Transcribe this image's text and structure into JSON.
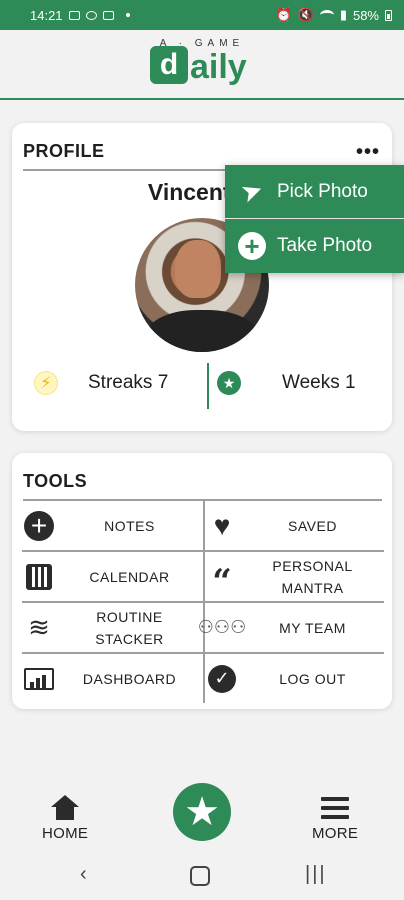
{
  "status_bar": {
    "time": "14:21",
    "battery": "58%"
  },
  "header": {
    "tagline": "A · GAME",
    "logo_mark": "d",
    "logo_rest": "aily"
  },
  "profile": {
    "title": "PROFILE",
    "more_label": "•••",
    "name": "Vincent M",
    "streaks": "Streaks 7",
    "weeks": "Weeks 1"
  },
  "popup_menu": {
    "items": [
      {
        "label": "Pick Photo",
        "icon": "paper-plane-icon"
      },
      {
        "label": "Take Photo",
        "icon": "plus-circle-icon"
      }
    ]
  },
  "tools": {
    "title": "TOOLS",
    "items": [
      {
        "label": "NOTES",
        "icon": "plus-circle-icon"
      },
      {
        "label": "SAVED",
        "icon": "heart-icon"
      },
      {
        "label": "CALENDAR",
        "icon": "calendar-icon"
      },
      {
        "label": "PERSONAL\nMANTRA",
        "icon": "quote-icon"
      },
      {
        "label": "ROUTINE\nSTACKER",
        "icon": "layers-icon"
      },
      {
        "label": "MY TEAM",
        "icon": "team-icon"
      },
      {
        "label": "DASHBOARD",
        "icon": "dashboard-icon"
      },
      {
        "label": "LOG OUT",
        "icon": "check-circle-icon"
      }
    ]
  },
  "bottom_nav": {
    "home": "HOME",
    "more": "MORE"
  },
  "colors": {
    "brand_green": "#2e8b57",
    "background": "#f2f2f2",
    "card": "#ffffff"
  }
}
